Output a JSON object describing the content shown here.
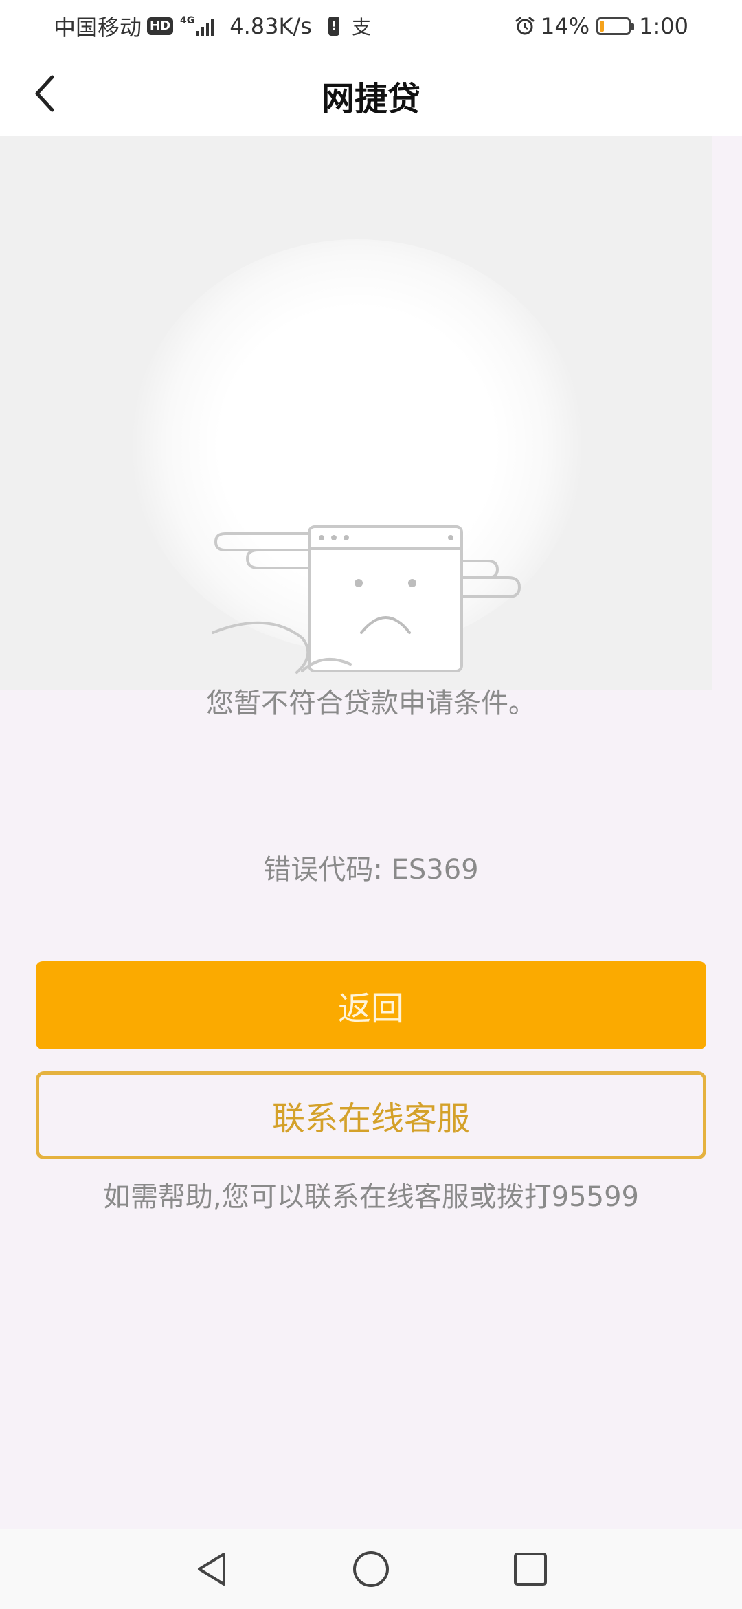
{
  "status_bar": {
    "carrier": "中国移动",
    "hd": "HD",
    "network": "4G",
    "speed": "4.83K/s",
    "warning": "!",
    "pay": "支",
    "battery_pct": "14%",
    "time": "1:00",
    "battery_level": 0.14,
    "battery_color": "#f5a21b"
  },
  "nav": {
    "title": "网捷贷"
  },
  "main": {
    "message": "您暂不符合贷款申请条件。",
    "error_code": "错误代码: ES369",
    "return_button": "返回",
    "contact_button": "联系在线客服",
    "help_text": "如需帮助,您可以联系在线客服或拨打95599"
  },
  "colors": {
    "primary": "#fbaa00",
    "secondary_border": "#e5b23f",
    "page_background": "#f7f2f8"
  },
  "icons": {
    "back": "chevron-left-icon",
    "illustration": "sad-window-icon",
    "system_back": "triangle-back-icon",
    "system_home": "circle-home-icon",
    "system_recents": "square-recents-icon"
  }
}
